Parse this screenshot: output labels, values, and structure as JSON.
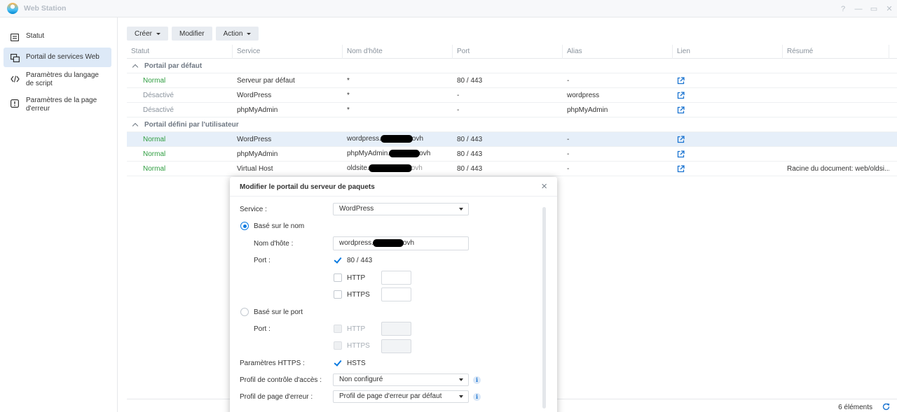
{
  "app": {
    "title": "Web Station",
    "window_controls": [
      "?",
      "—",
      "▭",
      "✕"
    ]
  },
  "sidebar": {
    "items": [
      {
        "label": "Statut",
        "icon": "status-list-icon",
        "active": false
      },
      {
        "label": "Portail de services Web",
        "icon": "portal-windows-icon",
        "active": true
      },
      {
        "label": "Paramètres du langage de script",
        "icon": "code-brackets-icon",
        "active": false
      },
      {
        "label": "Paramètres de la page d'erreur",
        "icon": "exclamation-icon",
        "active": false
      }
    ]
  },
  "toolbar": {
    "create_label": "Créer",
    "modify_label": "Modifier",
    "action_label": "Action"
  },
  "table": {
    "columns": [
      "Statut",
      "Service",
      "Nom d'hôte",
      "Port",
      "Alias",
      "Lien",
      "Résumé"
    ],
    "groups": [
      {
        "label": "Portail par défaut",
        "rows": [
          {
            "status": "Normal",
            "service": "Serveur par défaut",
            "host": "*",
            "port": "80 / 443",
            "alias": "-",
            "link": true,
            "summary": ""
          },
          {
            "status": "Désactivé",
            "service": "WordPress",
            "host": "*",
            "port": "-",
            "alias": "wordpress",
            "link": true,
            "summary": ""
          },
          {
            "status": "Désactivé",
            "service": "phpMyAdmin",
            "host": "*",
            "port": "-",
            "alias": "phpMyAdmin",
            "link": true,
            "summary": ""
          }
        ]
      },
      {
        "label": "Portail défini par l'utilisateur",
        "rows": [
          {
            "status": "Normal",
            "service": "WordPress",
            "host_prefix": "wordpress.",
            "host_suffix": "ovh",
            "port": "80 / 443",
            "alias": "-",
            "link": true,
            "summary": "",
            "selected": true
          },
          {
            "status": "Normal",
            "service": "phpMyAdmin",
            "host_prefix": "phpMyAdmin.",
            "host_suffix": "ovh",
            "port": "80 / 443",
            "alias": "-",
            "link": true,
            "summary": ""
          },
          {
            "status": "Normal",
            "service": "Virtual Host",
            "host_prefix": "oldsite.",
            "host_suffix": "ovh",
            "port": "80 / 443",
            "alias": "-",
            "link": true,
            "summary": "Racine du document: web/oldsi..."
          }
        ]
      }
    ]
  },
  "footer": {
    "count": "6 éléments"
  },
  "dialog": {
    "title": "Modifier le portail du serveur de paquets",
    "service_label": "Service :",
    "service_value": "WordPress",
    "name_based_label": "Basé sur le nom",
    "hostname_label": "Nom d'hôte :",
    "hostname_prefix": "wordpress.",
    "hostname_suffix": "ovh",
    "port_label": "Port :",
    "port_8043_label": "80 / 443",
    "http_label": "HTTP",
    "https_label": "HTTPS",
    "port_based_label": "Basé sur le port",
    "port_label_2": "Port :",
    "http_label_2": "HTTP",
    "https_label_2": "HTTPS",
    "https_settings_label": "Paramètres HTTPS :",
    "hsts_label": "HSTS",
    "access_profile_label": "Profil de contrôle d'accès :",
    "access_profile_value": "Non configuré",
    "error_profile_label": "Profil de page d'erreur :",
    "error_profile_value": "Profil de page d'erreur par défaut"
  },
  "colors": {
    "accent": "#0a7ae0",
    "status_normal": "#2f9e41",
    "status_disabled": "#8a939d",
    "selected_row": "#e6eff9",
    "sidebar_active": "#dde9f7"
  }
}
